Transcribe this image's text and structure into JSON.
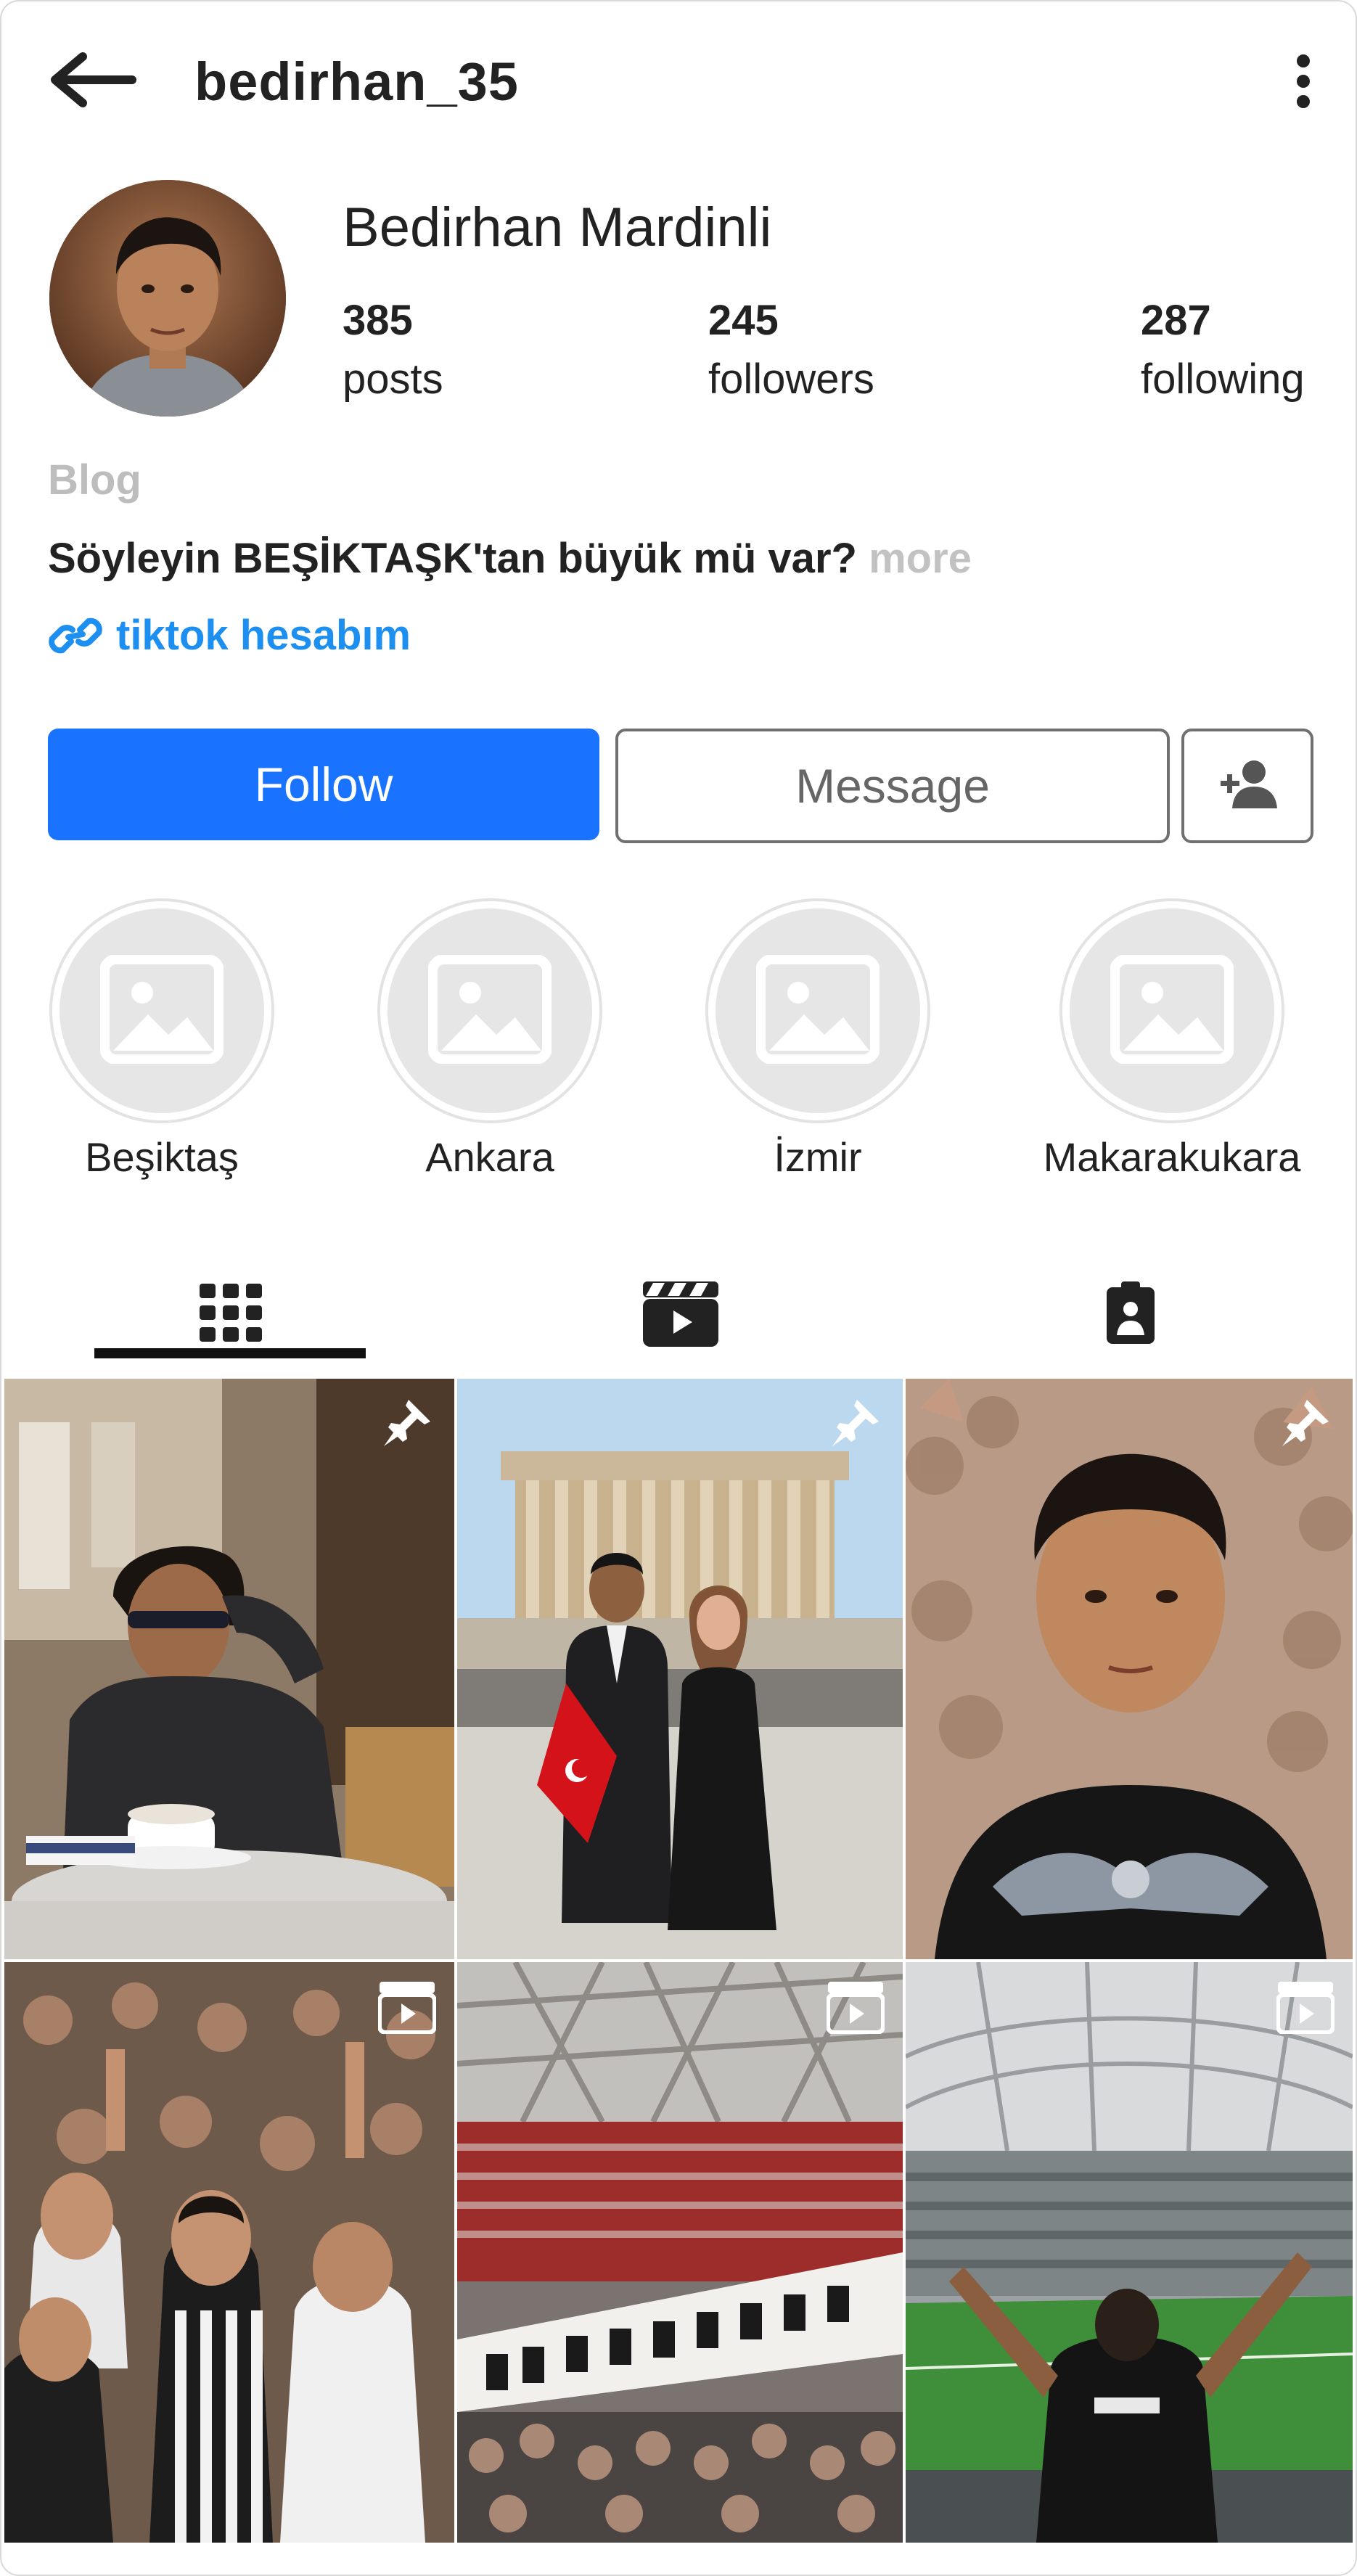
{
  "header": {
    "username": "bedirhan_35",
    "back_icon": "arrow-left-icon",
    "more_icon": "vertical-dots-icon"
  },
  "profile": {
    "display_name": "Bedirhan Mardinli",
    "stats": [
      {
        "value": "385",
        "label": "posts"
      },
      {
        "value": "245",
        "label": "followers"
      },
      {
        "value": "287",
        "label": "following"
      }
    ],
    "category": "Blog",
    "bio": "Söyleyin BEŞİKTAŞK'tan büyük mü var?",
    "bio_more": "more",
    "link_text": "tiktok hesabım",
    "link_icon": "link-icon"
  },
  "actions": {
    "follow_label": "Follow",
    "message_label": "Message",
    "add_user_icon": "add-user-icon"
  },
  "highlights": [
    {
      "label": "Beşiktaş"
    },
    {
      "label": "Ankara"
    },
    {
      "label": "İzmir"
    },
    {
      "label": "Makarakukara"
    }
  ],
  "tabs": [
    {
      "icon": "grid-icon",
      "active": true
    },
    {
      "icon": "reels-icon",
      "active": false
    },
    {
      "icon": "tagged-icon",
      "active": false
    }
  ],
  "posts": [
    {
      "subject": "man in sunglasses at cafe table with coffee",
      "badge": "pin-icon"
    },
    {
      "subject": "couple with Turkish flag at Anıtkabir",
      "badge": "pin-icon"
    },
    {
      "subject": "portrait of man in eagle t-shirt in crowd",
      "badge": "pin-icon"
    },
    {
      "subject": "football fans cheering in stands",
      "badge": "reel-icon"
    },
    {
      "subject": "stadium banner in stands",
      "badge": "reel-icon"
    },
    {
      "subject": "fan with raised arms facing stadium pitch",
      "badge": "reel-icon"
    }
  ],
  "colors": {
    "accent": "#1a73ff",
    "link": "#1d8ff0",
    "muted": "#bdbdbd",
    "text": "#222222"
  }
}
